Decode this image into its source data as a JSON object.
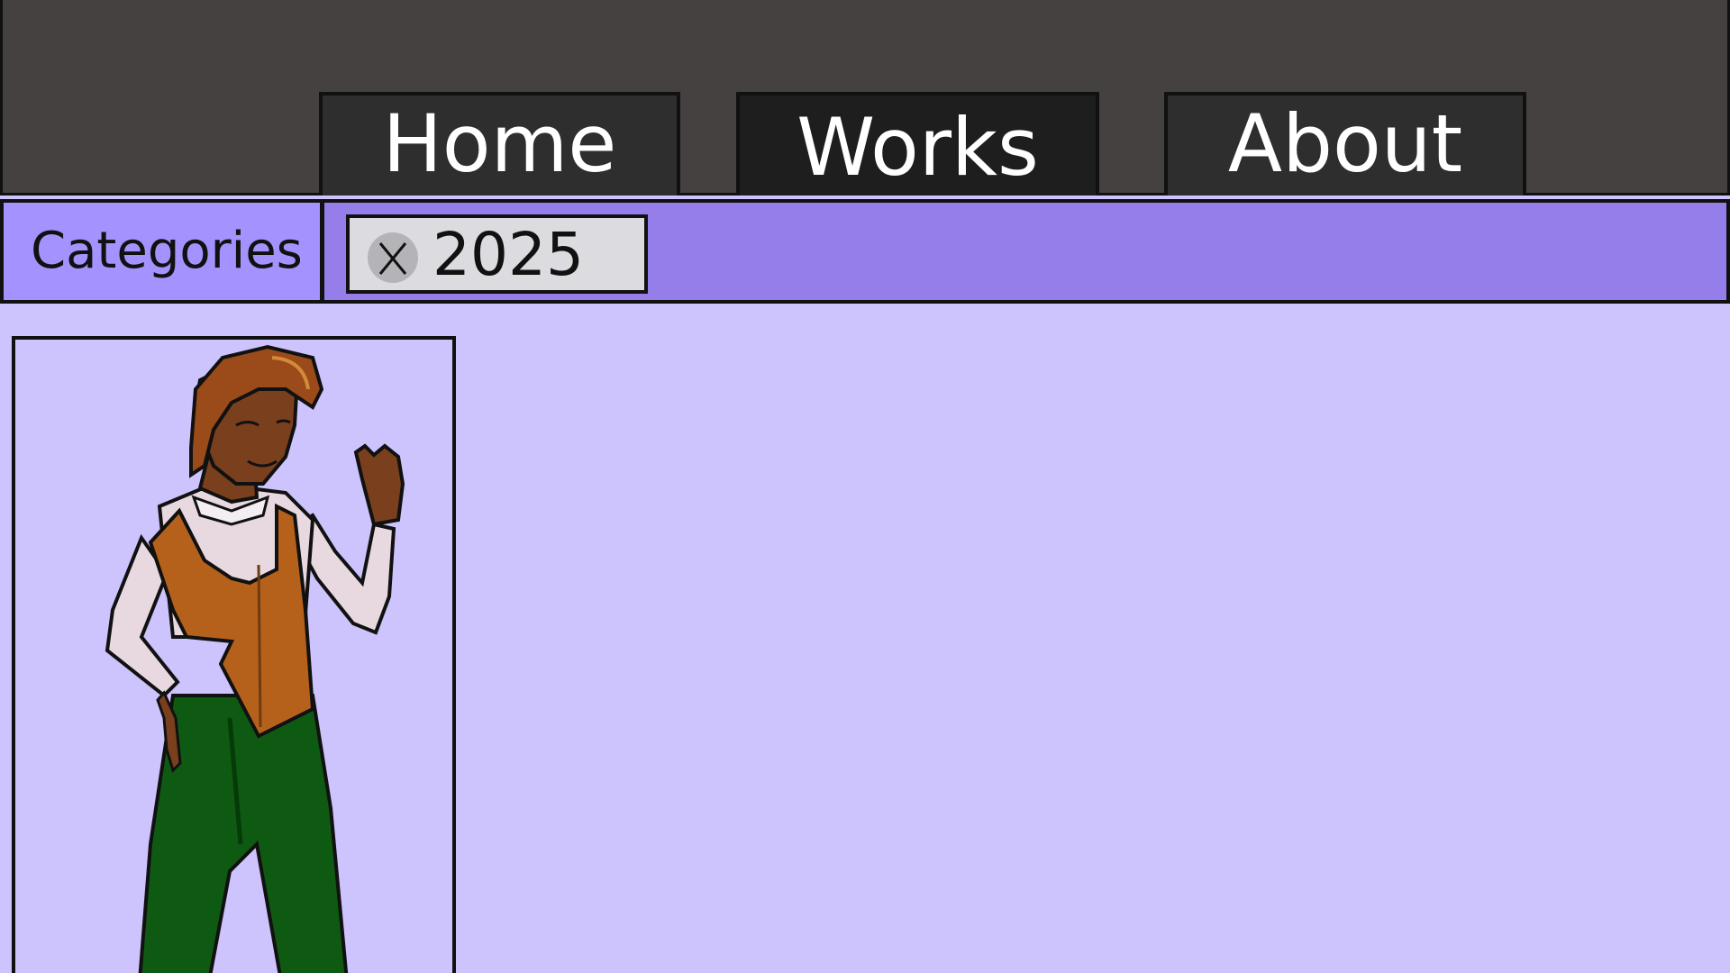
{
  "nav": {
    "items": [
      {
        "label": "Home"
      },
      {
        "label": "Works"
      },
      {
        "label": "About"
      }
    ],
    "active": "Works"
  },
  "categories": {
    "label": "Categories",
    "chips": [
      {
        "label": "2025"
      }
    ]
  },
  "gallery": {
    "items": [
      {
        "icon": "character-illustration"
      }
    ]
  },
  "colors": {
    "header_bg": "#454141",
    "nav_button_bg": "#2f2e2e",
    "nav_active_bg": "#1f1e1e",
    "category_bar_bg": "#957ee9",
    "category_label_bg": "#a493fe",
    "page_bg": "#cdc3fd",
    "chip_bg": "#dcdce0"
  }
}
